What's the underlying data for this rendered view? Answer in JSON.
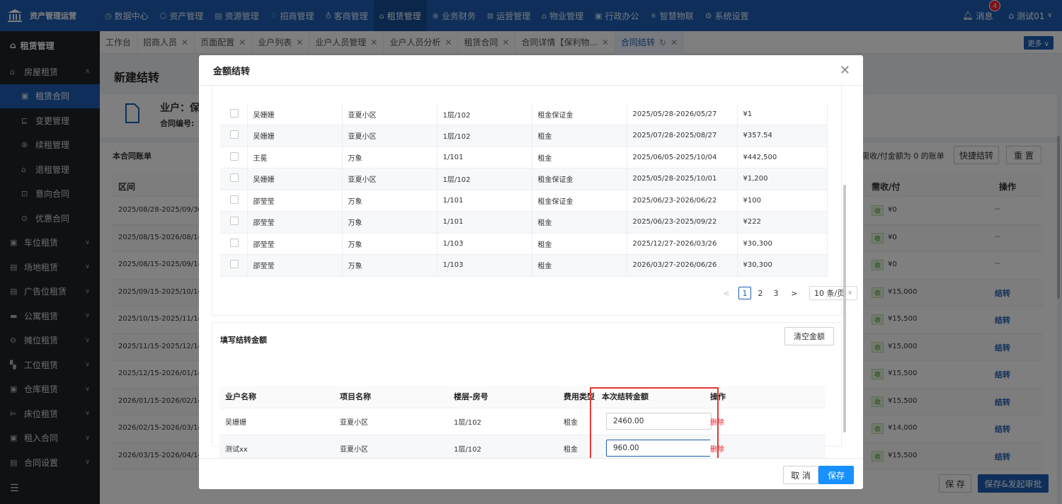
{
  "app": {
    "title": "资产管理运营"
  },
  "nav": [
    {
      "label": "数据中心",
      "icon": "◷"
    },
    {
      "label": "资产管理",
      "icon": "⬡"
    },
    {
      "label": "资源管理",
      "icon": "▤"
    },
    {
      "label": "招商管理",
      "icon": "♢"
    },
    {
      "label": "客商管理",
      "icon": "♁"
    },
    {
      "label": "租赁管理",
      "icon": "⌂"
    },
    {
      "label": "业务财务",
      "icon": "⊕"
    },
    {
      "label": "运营管理",
      "icon": "⊠"
    },
    {
      "label": "物业管理",
      "icon": "⌂"
    },
    {
      "label": "行政办公",
      "icon": "▣"
    },
    {
      "label": "智慧物联",
      "icon": "✳"
    },
    {
      "label": "系统设置",
      "icon": "⚙"
    }
  ],
  "topRight": {
    "messages": "消息",
    "badge": "4",
    "user": "测试01"
  },
  "sidebar": {
    "header": "租赁管理",
    "items": [
      {
        "label": "房屋租赁",
        "level": 1,
        "expanded": true
      },
      {
        "label": "租赁合同",
        "level": 2,
        "active": true
      },
      {
        "label": "变更管理",
        "level": 2
      },
      {
        "label": "续租管理",
        "level": 2
      },
      {
        "label": "退租管理",
        "level": 2
      },
      {
        "label": "意向合同",
        "level": 2
      },
      {
        "label": "优惠合同",
        "level": 2
      },
      {
        "label": "车位租赁",
        "level": 1
      },
      {
        "label": "场地租赁",
        "level": 1
      },
      {
        "label": "广告位租赁",
        "level": 1
      },
      {
        "label": "公寓租赁",
        "level": 1
      },
      {
        "label": "摊位租赁",
        "level": 1
      },
      {
        "label": "工位租赁",
        "level": 1
      },
      {
        "label": "仓库租赁",
        "level": 1
      },
      {
        "label": "床位租赁",
        "level": 1
      },
      {
        "label": "租入合同",
        "level": 1
      },
      {
        "label": "合同设置",
        "level": 1
      }
    ]
  },
  "tabs": [
    {
      "label": "工作台",
      "closable": false
    },
    {
      "label": "招商人员",
      "closable": true
    },
    {
      "label": "页面配置",
      "closable": true
    },
    {
      "label": "业户列表",
      "closable": true
    },
    {
      "label": "业户人员管理",
      "closable": true
    },
    {
      "label": "业户人员分析",
      "closable": true
    },
    {
      "label": "租赁合同",
      "closable": true
    },
    {
      "label": "合同详情【保利物...",
      "closable": true
    },
    {
      "label": "合同结转",
      "closable": true,
      "active": true
    }
  ],
  "moreLabel": "更多",
  "page": {
    "title": "新建结转",
    "ownerLabel": "业户：保",
    "contractLabel": "合同编号:",
    "billTitle": "本合同账单",
    "rangeHeader": "区间",
    "ranges": [
      "2025/08/28-2025/09/30",
      "2025/08/15-2026/08/14",
      "2025/08/15-2025/09/14",
      "2025/09/15-2025/10/14",
      "2025/10/15-2025/11/14",
      "2025/11/15-2025/12/14",
      "2025/12/15-2026/01/14",
      "2026/01/15-2026/02/14",
      "2026/02/15-2026/03/14",
      "2026/03/15-2026/04/14"
    ],
    "filterHint": "需收/付金额为 0 的账单",
    "quickBtn": "快捷结转",
    "resetBtn": "重 置",
    "dueHeader": "需收/付",
    "opHeader": "操作",
    "dueRows": [
      {
        "tag": "收",
        "amount": "¥0",
        "op": "--"
      },
      {
        "tag": "收",
        "amount": "¥0",
        "op": "--"
      },
      {
        "tag": "收",
        "amount": "¥0",
        "op": "--"
      },
      {
        "tag": "收",
        "amount": "¥15,000",
        "op": "结转"
      },
      {
        "tag": "收",
        "amount": "¥15,500",
        "op": "结转"
      },
      {
        "tag": "收",
        "amount": "¥15,000",
        "op": "结转"
      },
      {
        "tag": "收",
        "amount": "¥15,500",
        "op": "结转"
      },
      {
        "tag": "收",
        "amount": "¥15,500",
        "op": "结转"
      },
      {
        "tag": "收",
        "amount": "¥14,000",
        "op": "结转"
      },
      {
        "tag": "收",
        "amount": "¥15,500",
        "op": "结转"
      }
    ],
    "saveBtn": "保 存",
    "saveSubmitBtn": "保存&发起审批"
  },
  "modal": {
    "title": "金额结转",
    "billRows": [
      {
        "owner": "吴姗姗",
        "project": "亚夏小区",
        "room": "1层/102",
        "type": "租金保证金",
        "period": "2025/05/28-2026/05/27",
        "amount": "¥1"
      },
      {
        "owner": "吴姗姗",
        "project": "亚夏小区",
        "room": "1层/102",
        "type": "租金",
        "period": "2025/07/28-2025/08/27",
        "amount": "¥357.54"
      },
      {
        "owner": "王冕",
        "project": "万象",
        "room": "1/101",
        "type": "租金",
        "period": "2025/06/05-2025/10/04",
        "amount": "¥442,500"
      },
      {
        "owner": "吴姗姗",
        "project": "亚夏小区",
        "room": "1层/102",
        "type": "租金保证金",
        "period": "2025/05/28-2025/10/01",
        "amount": "¥1,200"
      },
      {
        "owner": "邵莹莹",
        "project": "万象",
        "room": "1/101",
        "type": "租金保证金",
        "period": "2025/06/23-2026/06/22",
        "amount": "¥100"
      },
      {
        "owner": "邵莹莹",
        "project": "万象",
        "room": "1/101",
        "type": "租金",
        "period": "2025/06/23-2025/09/22",
        "amount": "¥222"
      },
      {
        "owner": "邵莹莹",
        "project": "万象",
        "room": "1/103",
        "type": "租金",
        "period": "2025/12/27-2026/03/26",
        "amount": "¥30,300"
      },
      {
        "owner": "邵莹莹",
        "project": "万象",
        "room": "1/103",
        "type": "租金",
        "period": "2026/03/27-2026/06/26",
        "amount": "¥30,300"
      }
    ],
    "pager": {
      "prev": "<",
      "pages": [
        "1",
        "2",
        "3"
      ],
      "current": "1",
      "next": ">",
      "size": "10 条/页"
    },
    "fillTitle": "填写结转金额",
    "clearBtn": "清空金额",
    "fillHeaders": {
      "owner": "业户名称",
      "project": "项目名称",
      "room": "楼层-房号",
      "type": "费用类型",
      "amount": "本次结转金额",
      "op": "操作"
    },
    "fillRows": [
      {
        "owner": "吴姗姗",
        "project": "亚夏小区",
        "room": "1层/102",
        "type": "租金",
        "amount": "2460.00",
        "op": "删除"
      },
      {
        "owner": "测试xx",
        "project": "亚夏小区",
        "room": "1层/102",
        "type": "租金",
        "amount": "960.00",
        "op": "删除"
      }
    ],
    "cancelBtn": "取 消",
    "saveBtn": "保存"
  }
}
